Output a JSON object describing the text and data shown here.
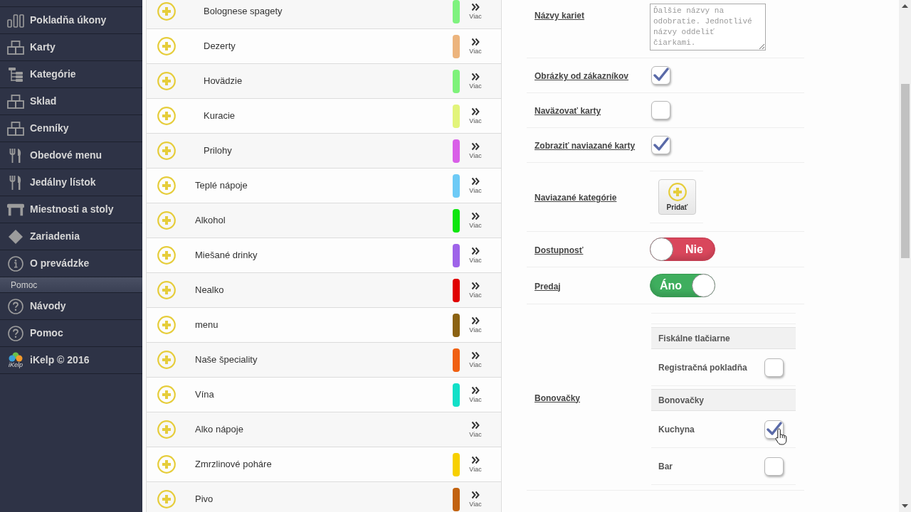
{
  "sidebar": {
    "groups": [
      {
        "items": [
          {
            "kind": "chart",
            "label": "Pokladňa úkony"
          },
          {
            "kind": "boxes",
            "label": "Karty"
          },
          {
            "kind": "tree",
            "label": "Kategórie"
          },
          {
            "kind": "boxes",
            "label": "Sklad"
          },
          {
            "kind": "boxes",
            "label": "Cenníky"
          },
          {
            "kind": "cutlery",
            "label": "Obedové menu"
          },
          {
            "kind": "cutlery",
            "label": "Jedálny lístok"
          },
          {
            "kind": "table",
            "label": "Miestnosti a stoly"
          },
          {
            "kind": "diamond",
            "label": "Zariadenia"
          },
          {
            "kind": "info",
            "label": "O prevádzke"
          }
        ]
      },
      {
        "title": "Pomoc",
        "items": [
          {
            "kind": "help",
            "label": "Návody"
          },
          {
            "kind": "help",
            "label": "Pomoc"
          },
          {
            "kind": "logo",
            "label": "iKelp © 2016",
            "logo_text": "iKelp"
          }
        ]
      }
    ]
  },
  "categories": {
    "rows": [
      {
        "children": [
          {
            "name": "Bolognese spagety",
            "color": "#7ff27f",
            "more": "Viac"
          },
          {
            "name": "Dezerty",
            "color": "#ecb47d",
            "more": "Viac"
          },
          {
            "name": "Hovädzie",
            "color": "#7ef27a",
            "more": "Viac"
          },
          {
            "name": "Kuracie",
            "color": "#e2f47a",
            "more": "Viac"
          },
          {
            "name": "Prilohy",
            "color": "#d95fe8",
            "more": "Viac"
          }
        ]
      },
      {
        "name": "Teplé nápoje",
        "color": "#6dcaf6",
        "more": "Viac"
      },
      {
        "name": "Alkohol",
        "color": "#0de60d",
        "more": "Viac"
      },
      {
        "name": "Miešané drinky",
        "color": "#9e63e9",
        "more": "Viac"
      },
      {
        "name": "Nealko",
        "color": "#e00000",
        "more": "Viac"
      },
      {
        "name": "menu",
        "color": "#8b6212",
        "more": "Viac"
      },
      {
        "name": "Naše špeciality",
        "color": "#f06012",
        "more": "Viac"
      },
      {
        "name": "Vína",
        "color": "#12e0c8",
        "more": "Viac"
      },
      {
        "name": "Alko nápoje",
        "more": "Viac"
      },
      {
        "name": "Zmrzlinové poháre",
        "color": "#f7d000",
        "more": "Viac"
      },
      {
        "name": "Pivo",
        "color": "#c2620f",
        "more": "Viac"
      }
    ]
  },
  "form": {
    "fields": [
      {
        "kind": "textarea",
        "label": "Názvy kariet",
        "placeholder": "Ďalšie názvy na odobratie. Jednotlivé názvy oddeliť čiarkami."
      },
      {
        "kind": "checkbox",
        "label": "Obrázky od zákazníkov",
        "checked": true
      },
      {
        "kind": "checkbox",
        "label": "Naväzovať karty",
        "checked": false
      },
      {
        "kind": "checkbox",
        "label": "Zobraziť naviazané karty",
        "checked": true
      },
      {
        "kind": "add",
        "label": "Naviazané kategórie",
        "button": "Pridať"
      },
      {
        "kind": "toggle",
        "label": "Dostupnosť",
        "on": false,
        "text": "Nie"
      },
      {
        "kind": "toggle",
        "label": "Predaj",
        "on": true,
        "text": "Áno"
      },
      {
        "kind": "options",
        "label": "Bonovačky",
        "groups": [
          {
            "title": "Fiskálne tlačiarne",
            "items": [
              {
                "label": "Registračná pokladňa",
                "checked": false
              }
            ]
          },
          {
            "title": "Bonovačky",
            "items": [
              {
                "label": "Kuchyna",
                "checked": true
              },
              {
                "label": "Bar",
                "checked": false
              }
            ]
          }
        ]
      }
    ]
  }
}
